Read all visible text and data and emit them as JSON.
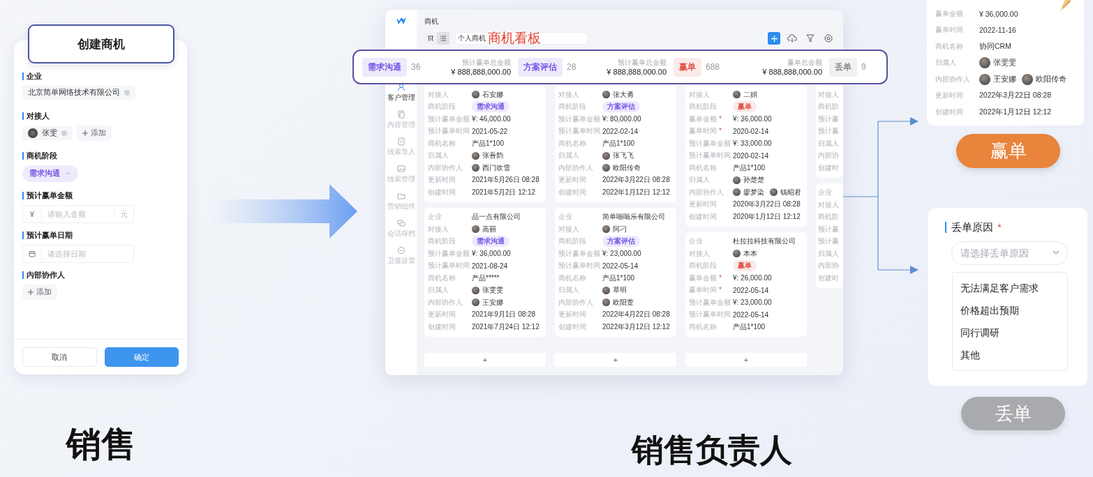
{
  "form": {
    "title": "创建商机",
    "fields": [
      {
        "kind": "chip",
        "label": "企业",
        "value": "北京简单网络技术有限公司"
      },
      {
        "kind": "person",
        "label": "对接人",
        "value": "张雯",
        "add": "添加"
      },
      {
        "kind": "stage",
        "label": "商机阶段",
        "value": "需求沟通",
        "color": "#7454e6"
      },
      {
        "kind": "amount",
        "label": "预计赢单金额",
        "prefix": "¥",
        "placeholder": "请输入金额",
        "suffix": "元"
      },
      {
        "kind": "date",
        "label": "预计赢单日期",
        "placeholder": "请选择日期"
      },
      {
        "kind": "add",
        "label": "内部协作人",
        "add": "添加"
      }
    ],
    "buttons": [
      {
        "label": "取消",
        "primary": false
      },
      {
        "label": "确定",
        "primary": true
      }
    ]
  },
  "caption_left": "销售",
  "window": {
    "title": "商机",
    "view_toggle": [
      {
        "selected": false
      },
      {
        "selected": true
      }
    ],
    "view_field": "个人商机",
    "annotation": "商机看板",
    "sidebar": [
      {
        "label": "客户管理",
        "selected": true
      },
      {
        "label": "内容管理",
        "selected": false
      },
      {
        "label": "线索导入",
        "selected": false
      },
      {
        "label": "线索管理",
        "selected": false
      },
      {
        "label": "营销组件",
        "selected": false
      },
      {
        "label": "会话存档",
        "selected": false
      },
      {
        "label": "卫值设置",
        "selected": false
      }
    ],
    "summary": [
      {
        "stage": "需求沟通",
        "color": "#7454e6",
        "count": "36",
        "total_label": "预计赢单总金额",
        "total": "¥ 888,888,000.00"
      },
      {
        "stage": "方案评估",
        "color": "#7454e6",
        "count": "28",
        "total_label": "预计赢单总金额",
        "total": "¥ 888,888,000.00"
      },
      {
        "stage": "赢单",
        "color": "#e0534a",
        "count": "688",
        "total_label": "赢单总金额",
        "total": "¥ 888,888,000.00"
      },
      {
        "stage": "丢单",
        "color": "#8a8a8a",
        "count": "9"
      }
    ],
    "columns": [
      {
        "add": "+",
        "cards": [
          {
            "rows": [
              {
                "label": "对接人",
                "kind": "person",
                "value": "石安娜"
              },
              {
                "label": "商机阶段",
                "kind": "tag",
                "value": "需求沟通",
                "color": "#7454e6"
              },
              {
                "label": "预计赢单金额",
                "kind": "text",
                "value": "¥: 46,000.00"
              },
              {
                "label": "预计赢单时间",
                "kind": "text",
                "value": "2021-05-22"
              },
              {
                "label": "商机名称",
                "kind": "text",
                "value": "产品1*100"
              },
              {
                "label": "归属人",
                "kind": "person",
                "value": "张吾韵"
              },
              {
                "label": "内部协作人",
                "kind": "person",
                "value": "西门吹雪"
              },
              {
                "label": "更新时间",
                "kind": "text",
                "value": "2021年5月26日 08:28"
              },
              {
                "label": "创建时间",
                "kind": "text",
                "value": "2021年5月2日 12:12"
              }
            ]
          },
          {
            "rows": [
              {
                "label": "企业",
                "kind": "text",
                "value": "品一点有限公司"
              },
              {
                "label": "对接人",
                "kind": "person",
                "value": "高丽"
              },
              {
                "label": "商机阶段",
                "kind": "tag",
                "value": "需求沟通",
                "color": "#7454e6"
              },
              {
                "label": "预计赢单金额",
                "kind": "text",
                "value": "¥: 36,000.00"
              },
              {
                "label": "预计赢单时间",
                "kind": "text",
                "value": "2021-08-24"
              },
              {
                "label": "商机名称",
                "kind": "text",
                "value": "产品*****"
              },
              {
                "label": "归属人",
                "kind": "person",
                "value": "张雯雯"
              },
              {
                "label": "内部协作人",
                "kind": "person",
                "value": "王安娜"
              },
              {
                "label": "更新时间",
                "kind": "text",
                "value": "2021年9月1日 08:28"
              },
              {
                "label": "创建时间",
                "kind": "text",
                "value": "2021年7月24日 12:12"
              }
            ]
          }
        ]
      },
      {
        "add": "+",
        "cards": [
          {
            "rows": [
              {
                "label": "对接人",
                "kind": "person",
                "value": "张大勇"
              },
              {
                "label": "商机阶段",
                "kind": "tag",
                "value": "方案评估",
                "color": "#7454e6"
              },
              {
                "label": "预计赢单金额",
                "kind": "text",
                "value": "¥: 80,000.00"
              },
              {
                "label": "预计赢单时间",
                "kind": "text",
                "value": "2022-02-14"
              },
              {
                "label": "商机名称",
                "kind": "text",
                "value": "产品1*100"
              },
              {
                "label": "归属人",
                "kind": "person",
                "value": "张飞飞"
              },
              {
                "label": "内部协作人",
                "kind": "person",
                "value": "欧阳传奇"
              },
              {
                "label": "更新时间",
                "kind": "text",
                "value": "2022年3月22日 08:28"
              },
              {
                "label": "创建时间",
                "kind": "text",
                "value": "2022年1月12日 12:12"
              }
            ]
          },
          {
            "rows": [
              {
                "label": "企业",
                "kind": "text",
                "value": "简单嗡嗡乐有限公司"
              },
              {
                "label": "对接人",
                "kind": "person",
                "value": "阿刁"
              },
              {
                "label": "商机阶段",
                "kind": "tag",
                "value": "方案评估",
                "color": "#7454e6"
              },
              {
                "label": "预计赢单金额",
                "kind": "text",
                "value": "¥: 23,000.00"
              },
              {
                "label": "预计赢单时间",
                "kind": "text",
                "value": "2022-05-14"
              },
              {
                "label": "商机名称",
                "kind": "text",
                "value": "产品1*100"
              },
              {
                "label": "归属人",
                "kind": "person",
                "value": "草明"
              },
              {
                "label": "内部协作人",
                "kind": "person",
                "value": "欧阳萱"
              },
              {
                "label": "更新时间",
                "kind": "text",
                "value": "2022年4月22日 08:28"
              },
              {
                "label": "创建时间",
                "kind": "text",
                "value": "2022年3月12日 12:12"
              }
            ]
          }
        ]
      },
      {
        "add": "+",
        "cards": [
          {
            "rows": [
              {
                "label": "对接人",
                "kind": "person",
                "value": "二娟"
              },
              {
                "label": "商机阶段",
                "kind": "tag",
                "value": "赢单",
                "color": "#e0534a"
              },
              {
                "label": "赢单金额",
                "mark": "*",
                "kind": "text",
                "value": "¥: 36,000.00"
              },
              {
                "label": "赢单时间",
                "mark": "*",
                "kind": "text",
                "value": "2020-02-14"
              },
              {
                "label": "预计赢单金额",
                "kind": "text",
                "value": "¥: 33,000.00"
              },
              {
                "label": "预计赢单时间",
                "kind": "text",
                "value": "2020-02-14"
              },
              {
                "label": "商机名称",
                "kind": "text",
                "value": "产品1*100"
              },
              {
                "label": "归属人",
                "kind": "person",
                "value": "孙楚楚"
              },
              {
                "label": "内部协作人",
                "kind": "people",
                "values": [
                  "廖梦染",
                  "钱昭君"
                ]
              },
              {
                "label": "更新时间",
                "kind": "text",
                "value": "2020年3月22日 08:28"
              },
              {
                "label": "创建时间",
                "kind": "text",
                "value": "2020年1月12日 12:12"
              }
            ]
          },
          {
            "rows": [
              {
                "label": "企业",
                "kind": "text",
                "value": "杜拉拉科技有限公司"
              },
              {
                "label": "对接人",
                "kind": "person",
                "value": "本本"
              },
              {
                "label": "商机阶段",
                "kind": "tag",
                "value": "赢单",
                "color": "#e0534a"
              },
              {
                "label": "赢单金额",
                "mark": "*",
                "kind": "text",
                "value": "¥: 26,000.00"
              },
              {
                "label": "赢单时间",
                "mark": "*",
                "kind": "text",
                "value": "2022-05-14"
              },
              {
                "label": "预计赢单金额",
                "kind": "text",
                "value": "¥: 23,000.00"
              },
              {
                "label": "预计赢单时间",
                "kind": "text",
                "value": "2022-05-14"
              },
              {
                "label": "商机名称",
                "kind": "text",
                "value": "产品1*100"
              }
            ]
          }
        ]
      },
      {
        "cards": [
          {
            "rows": [
              {
                "label": "对接人",
                "kind": "label"
              },
              {
                "label": "商机阶",
                "kind": "label"
              },
              {
                "label": "预计赢",
                "kind": "label"
              },
              {
                "label": "预计赢",
                "kind": "label"
              },
              {
                "label": "归属人",
                "kind": "label"
              },
              {
                "label": "内部协",
                "kind": "label"
              },
              {
                "label": "创建时",
                "kind": "label"
              }
            ]
          },
          {
            "rows": [
              {
                "label": "企业",
                "kind": "label"
              },
              {
                "label": "对接人",
                "kind": "label"
              },
              {
                "label": "商机阶",
                "kind": "label"
              },
              {
                "label": "预计赢",
                "kind": "label"
              },
              {
                "label": "预计赢",
                "kind": "label"
              },
              {
                "label": "归属人",
                "kind": "label"
              },
              {
                "label": "内部协",
                "kind": "label"
              },
              {
                "label": "创建时",
                "kind": "label"
              }
            ]
          }
        ]
      }
    ]
  },
  "caption_center": "销售负责人",
  "won_card": {
    "rows": [
      {
        "label": "赢单金额",
        "kind": "text",
        "value": "¥ 36,000.00"
      },
      {
        "label": "赢单时间",
        "kind": "text",
        "value": "2022-11-16"
      },
      {
        "label": "商机名称",
        "kind": "text",
        "value": "协同CRM"
      },
      {
        "label": "归属人",
        "kind": "person",
        "value": "张雯雯"
      },
      {
        "label": "内部协作人",
        "kind": "people",
        "values": [
          "王安娜",
          "欧阳传奇"
        ]
      },
      {
        "label": "更新时间",
        "kind": "text",
        "value": "2022年3月22日 08:28"
      },
      {
        "label": "创建时间",
        "kind": "text",
        "value": "2022年1月12日 12:12"
      }
    ]
  },
  "won_button": "赢单",
  "lost_card": {
    "label": "丢单原因",
    "mark": "*",
    "placeholder": "请选择丢单原因",
    "options": [
      "无法满足客户需求",
      "价格超出预期",
      "同行调研",
      "其他"
    ]
  },
  "lost_button": "丢单"
}
